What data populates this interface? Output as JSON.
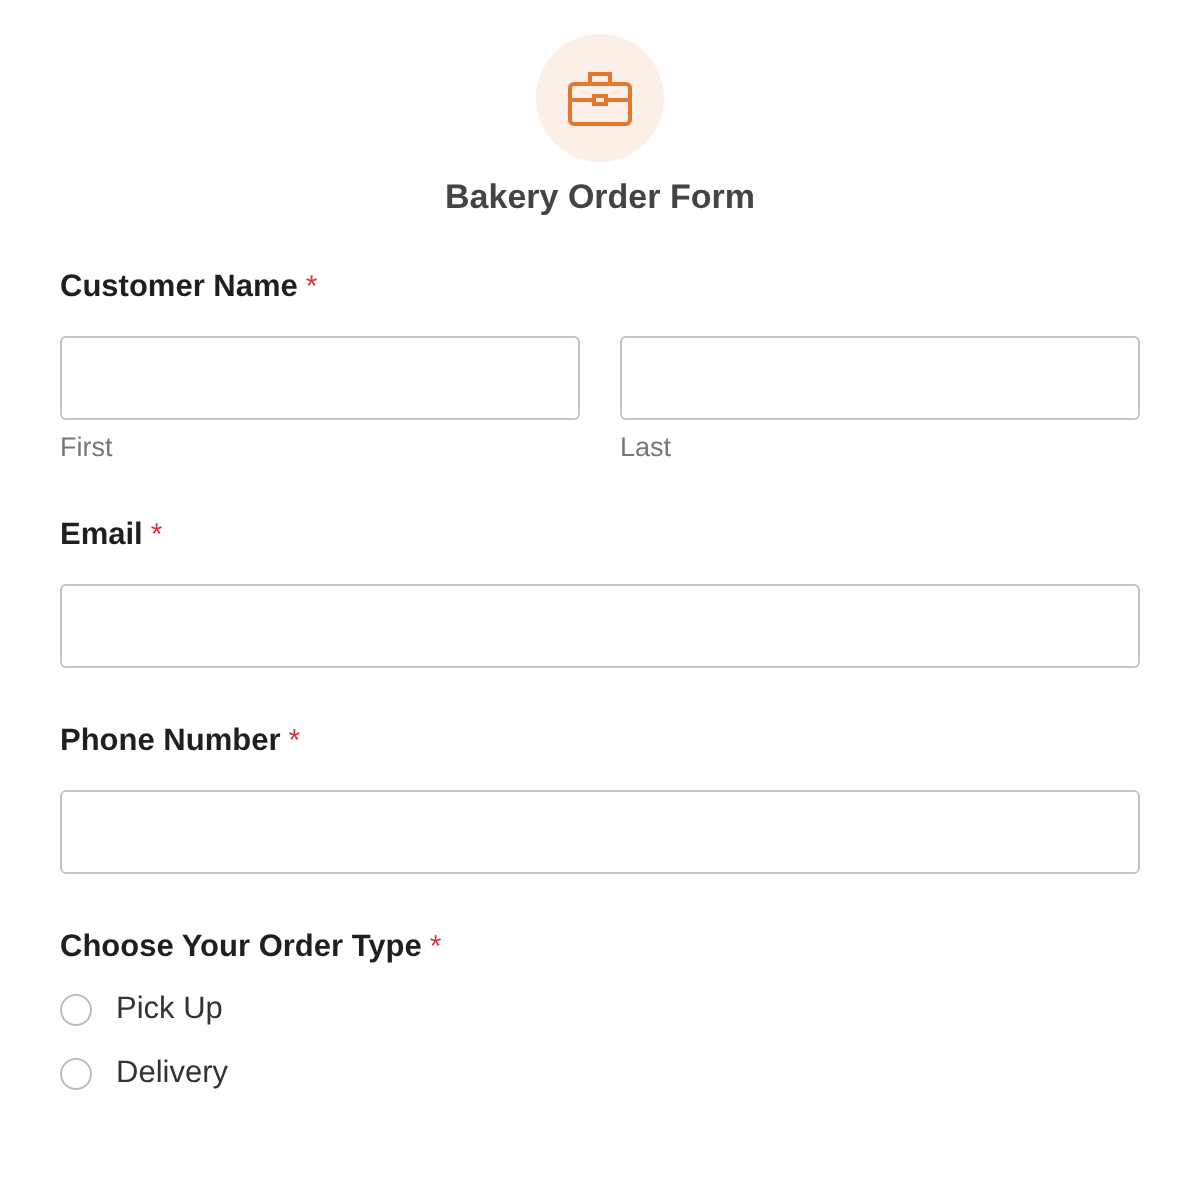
{
  "form": {
    "title": "Bakery Order Form"
  },
  "fields": [
    {
      "kind": "name",
      "label": "Customer Name",
      "required_mark": "*",
      "inputs": [
        {
          "sublabel": "First"
        },
        {
          "sublabel": "Last"
        }
      ]
    },
    {
      "kind": "text",
      "label": "Email",
      "required_mark": "*"
    },
    {
      "kind": "text",
      "label": "Phone Number",
      "required_mark": "*"
    },
    {
      "kind": "radio",
      "label": "Choose Your Order Type",
      "required_mark": "*",
      "options": [
        {
          "label": "Pick Up",
          "selected": false
        },
        {
          "label": "Delivery",
          "selected": false
        }
      ]
    }
  ]
}
